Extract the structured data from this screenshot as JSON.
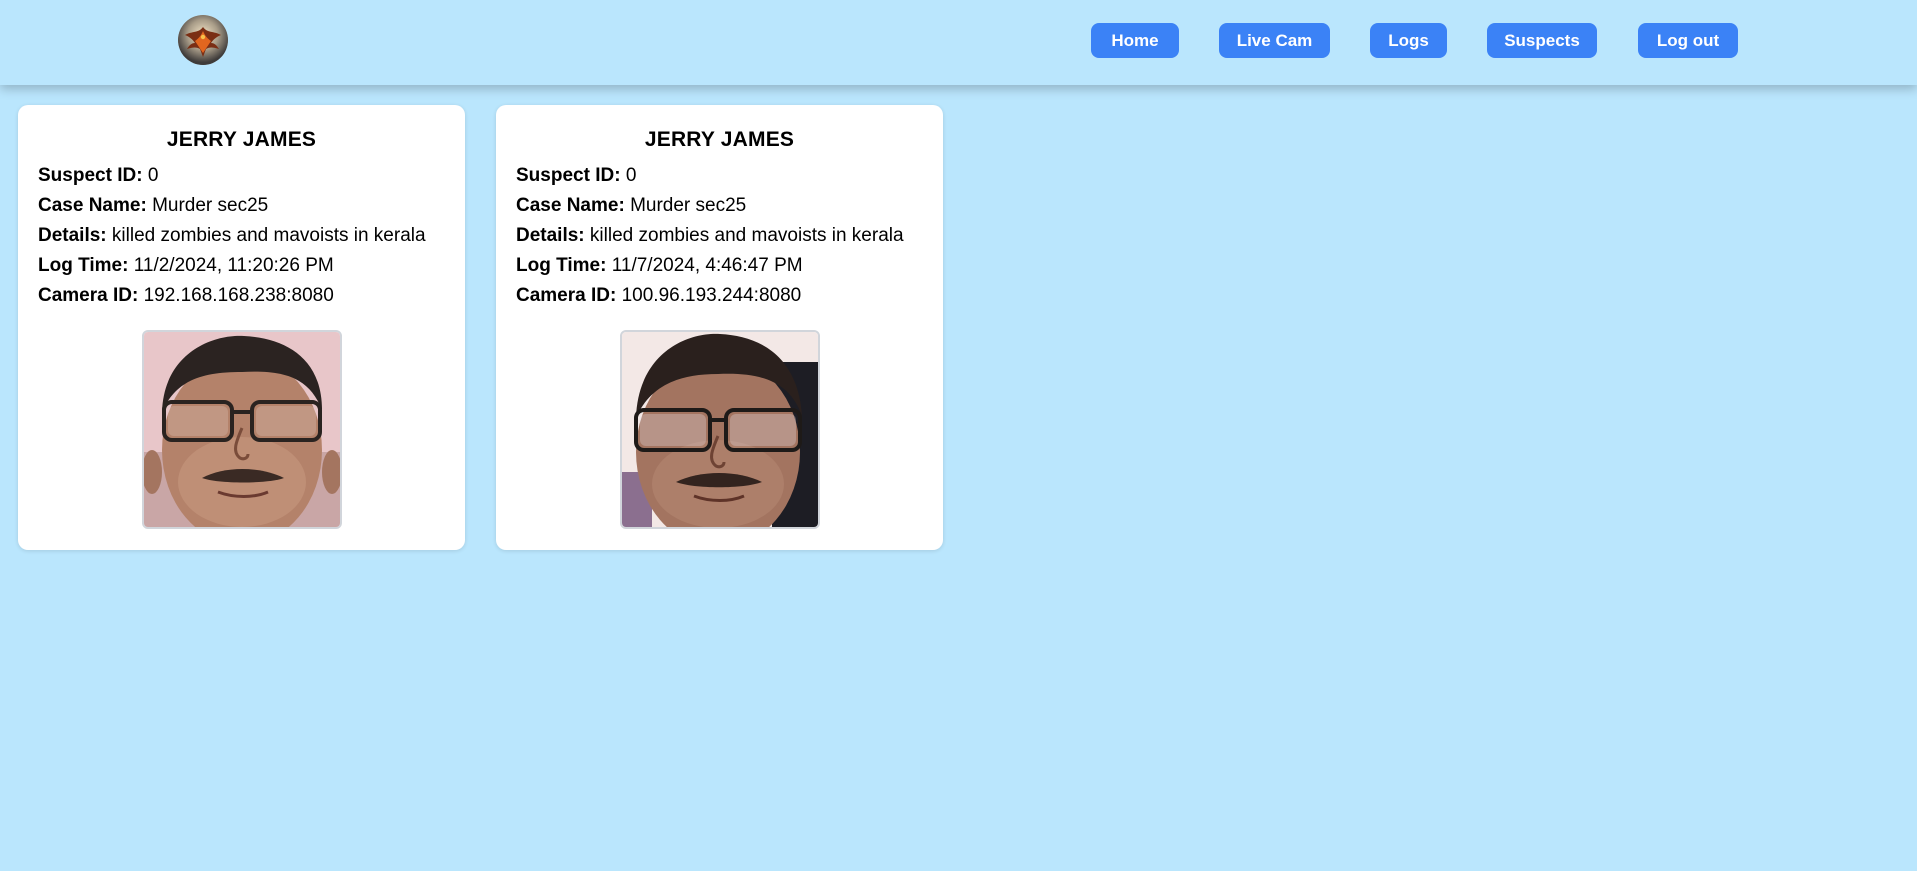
{
  "nav": {
    "logo": "phoenix-logo",
    "items": [
      {
        "label": "Home"
      },
      {
        "label": "Live Cam"
      },
      {
        "label": "Logs"
      },
      {
        "label": "Suspects"
      },
      {
        "label": "Log out"
      }
    ]
  },
  "labels": {
    "suspect_id": "Suspect ID:",
    "case_name": "Case Name:",
    "details": "Details:",
    "log_time": "Log Time:",
    "camera_id": "Camera ID:"
  },
  "logs": [
    {
      "name": "JERRY JAMES",
      "suspect_id": "0",
      "case_name": "Murder sec25",
      "details": "killed zombies and mavoists in kerala",
      "log_time": "11/2/2024, 11:20:26 PM",
      "camera_id": "192.168.168.238:8080",
      "photo": "suspect-face-photo"
    },
    {
      "name": "JERRY JAMES",
      "suspect_id": "0",
      "case_name": "Murder sec25",
      "details": "killed zombies and mavoists in kerala",
      "log_time": "11/7/2024, 4:46:47 PM",
      "camera_id": "100.96.193.244:8080",
      "photo": "suspect-face-photo"
    }
  ],
  "colors": {
    "background": "#bae6fd",
    "button": "#3b82f6",
    "card": "#ffffff"
  }
}
